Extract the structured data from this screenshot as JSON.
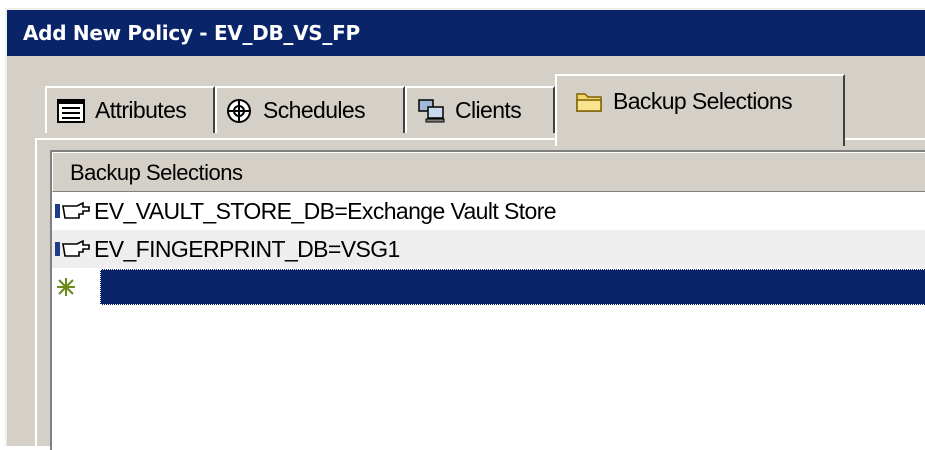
{
  "window": {
    "title": "Add New Policy - EV_DB_VS_FP"
  },
  "tabs": [
    {
      "label": "Attributes",
      "icon": "attributes-icon"
    },
    {
      "label": "Schedules",
      "icon": "schedules-icon"
    },
    {
      "label": "Clients",
      "icon": "clients-icon"
    },
    {
      "label": "Backup Selections",
      "icon": "folder-icon",
      "active": true
    }
  ],
  "selections": {
    "header": "Backup Selections",
    "rows": [
      {
        "text": "EV_VAULT_STORE_DB=Exchange Vault Store",
        "icon": "directive-pointer-icon"
      },
      {
        "text": "EV_FINGERPRINT_DB=VSG1",
        "icon": "directive-pointer-icon"
      },
      {
        "text": "",
        "icon": "new-entry-icon",
        "selected": true
      }
    ]
  },
  "colors": {
    "titlebar": "#0a246a",
    "selection": "#0a246a",
    "face": "#d4d0c8"
  }
}
